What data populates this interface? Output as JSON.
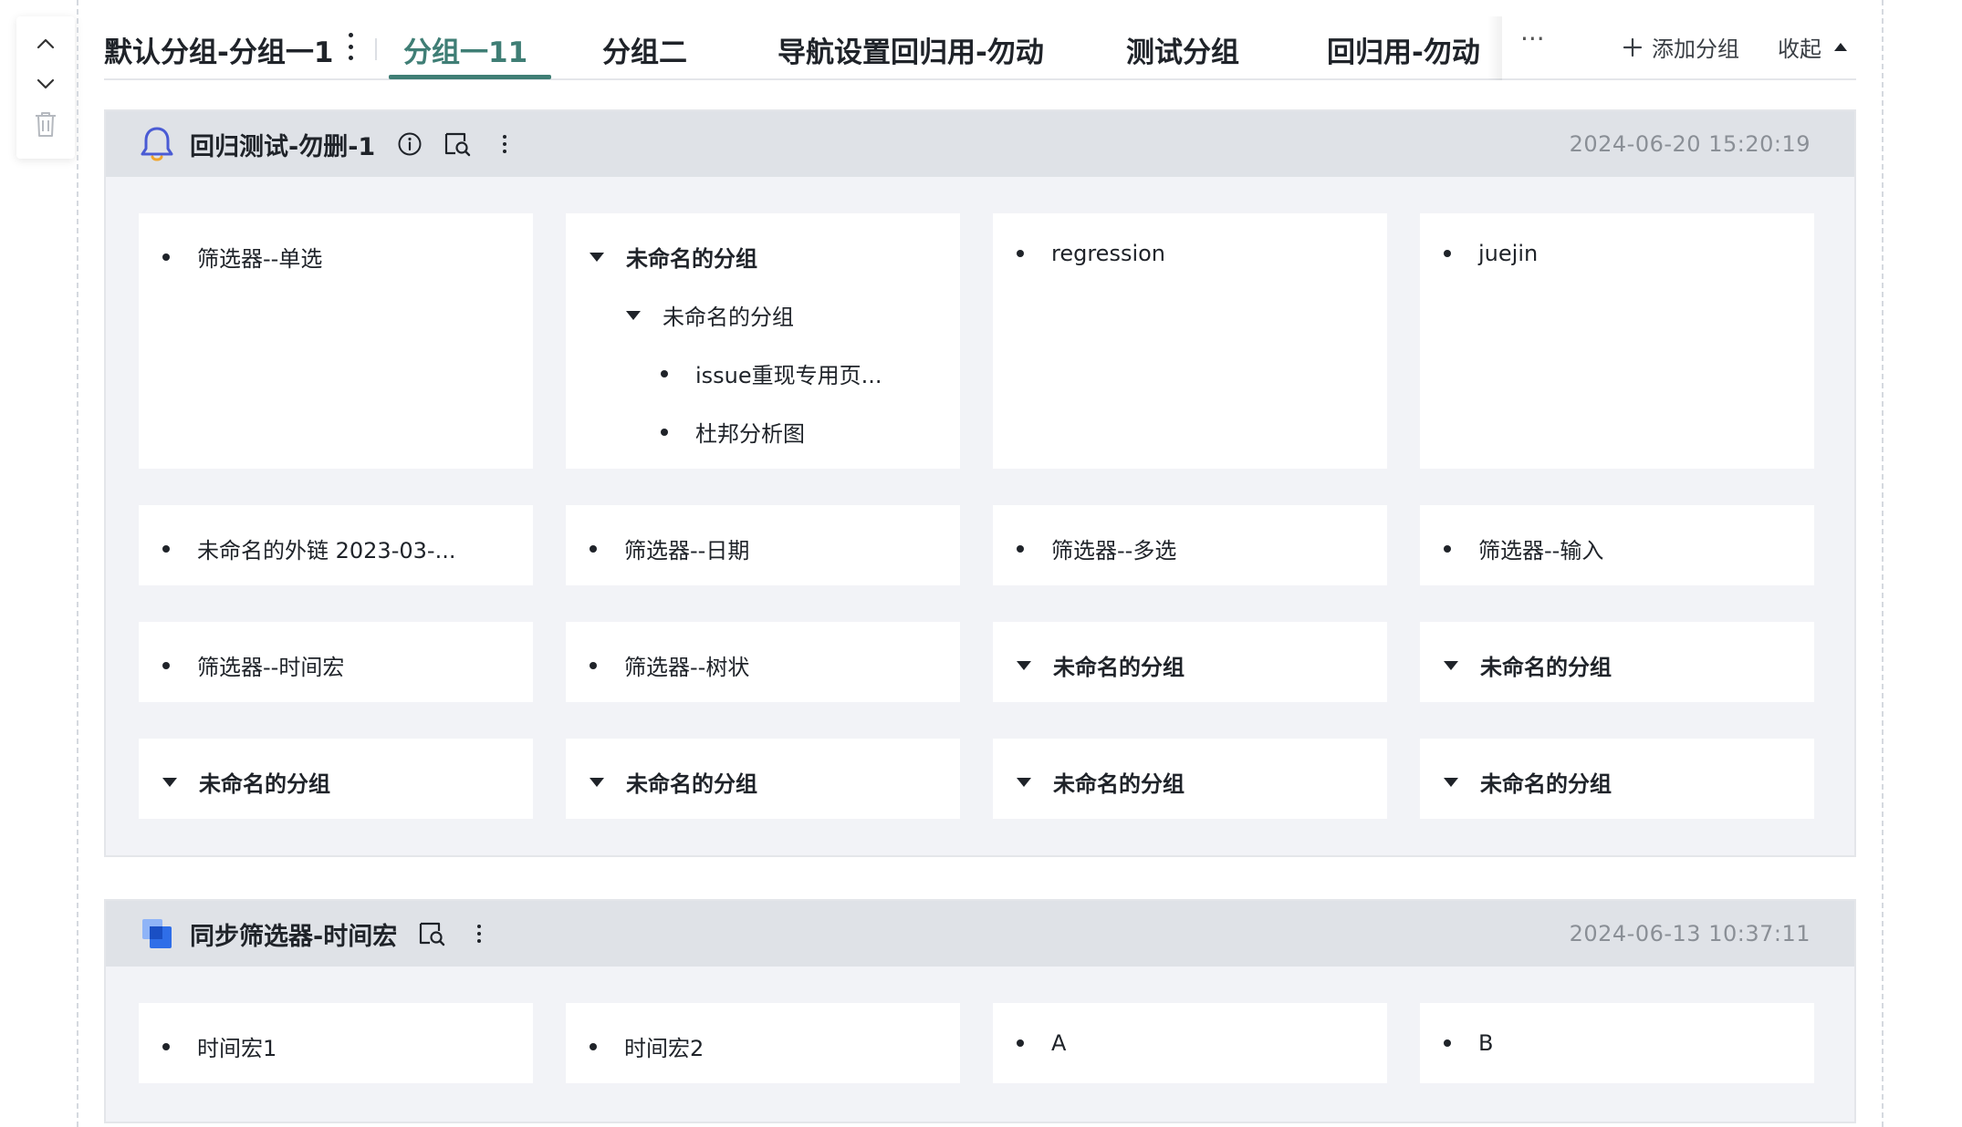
{
  "top_bar": {
    "group_title": "默认分组-分组一1",
    "tabs": [
      {
        "label": "分组一11",
        "active": true
      },
      {
        "label": "分组二",
        "active": false
      },
      {
        "label": "导航设置回归用-勿动",
        "active": false
      },
      {
        "label": "测试分组",
        "active": false
      },
      {
        "label": "回归用-勿动",
        "active": false
      }
    ],
    "more_tabs": "···",
    "add_group_label": "添加分组",
    "collapse_label": "收起"
  },
  "sections": [
    {
      "title": "回归测试-勿删-1",
      "timestamp": "2024-06-20 15:20:19",
      "icon": "bell-icon",
      "cards": [
        {
          "items": [
            {
              "type": "link",
              "label": "筛选器--单选"
            }
          ]
        },
        {
          "items": [
            {
              "type": "folder",
              "label": "未命名的分组",
              "level": 0
            },
            {
              "type": "folder",
              "label": "未命名的分组",
              "level": 1
            },
            {
              "type": "link",
              "label": "issue重现专用页...",
              "level": 2
            },
            {
              "type": "link",
              "label": "杜邦分析图",
              "level": 2
            }
          ]
        },
        {
          "items": [
            {
              "type": "link",
              "label": "regression"
            }
          ]
        },
        {
          "items": [
            {
              "type": "link",
              "label": "juejin"
            }
          ]
        },
        {
          "items": [
            {
              "type": "link",
              "label": "未命名的外链 2023-03-..."
            }
          ]
        },
        {
          "items": [
            {
              "type": "link",
              "label": "筛选器--日期"
            }
          ]
        },
        {
          "items": [
            {
              "type": "link",
              "label": "筛选器--多选"
            }
          ]
        },
        {
          "items": [
            {
              "type": "link",
              "label": "筛选器--输入"
            }
          ]
        },
        {
          "items": [
            {
              "type": "link",
              "label": "筛选器--时间宏"
            }
          ]
        },
        {
          "items": [
            {
              "type": "link",
              "label": "筛选器--树状"
            }
          ]
        },
        {
          "items": [
            {
              "type": "folder",
              "label": "未命名的分组"
            }
          ]
        },
        {
          "items": [
            {
              "type": "folder",
              "label": "未命名的分组"
            }
          ]
        },
        {
          "items": [
            {
              "type": "folder",
              "label": "未命名的分组"
            }
          ]
        },
        {
          "items": [
            {
              "type": "folder",
              "label": "未命名的分组"
            }
          ]
        },
        {
          "items": [
            {
              "type": "folder",
              "label": "未命名的分组"
            }
          ]
        },
        {
          "items": [
            {
              "type": "folder",
              "label": "未命名的分组"
            }
          ]
        }
      ]
    },
    {
      "title": "同步筛选器-时间宏",
      "timestamp": "2024-06-13 10:37:11",
      "icon": "layers-icon",
      "cards": [
        {
          "items": [
            {
              "type": "link",
              "label": "时间宏1"
            }
          ]
        },
        {
          "items": [
            {
              "type": "link",
              "label": "时间宏2"
            }
          ]
        },
        {
          "items": [
            {
              "type": "link",
              "label": "A"
            }
          ]
        },
        {
          "items": [
            {
              "type": "link",
              "label": "B"
            }
          ]
        }
      ]
    }
  ],
  "colors": {
    "accent": "#3f7e75",
    "header_bg": "#dfe2e7",
    "section_bg": "#f2f3f7",
    "timestamp": "#8a8f96",
    "bell": "#4a5bd4",
    "layers_light": "#8fb4f7",
    "layers_dark": "#2f6ee8"
  }
}
